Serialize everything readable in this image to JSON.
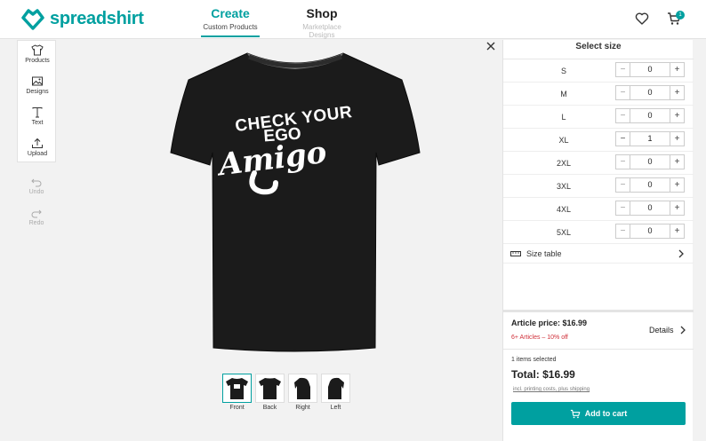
{
  "brand": {
    "name": "spreadshirt",
    "color": "#00a0a0"
  },
  "nav": {
    "tabs": [
      {
        "label": "Create",
        "sublabel": "Custom Products"
      },
      {
        "label": "Shop",
        "sublabel": "Marketplace Designs"
      }
    ],
    "cart_count": "1"
  },
  "tools": {
    "items": [
      {
        "label": "Products",
        "icon": "tshirt-icon"
      },
      {
        "label": "Designs",
        "icon": "image-icon"
      },
      {
        "label": "Text",
        "icon": "text-icon"
      },
      {
        "label": "Upload",
        "icon": "upload-icon"
      }
    ],
    "undo": "Undo",
    "redo": "Redo"
  },
  "design": {
    "line1": "CHECK YOUR",
    "line2": "EGO",
    "line3": "Amigo",
    "shirt_color": "#1b1b1b"
  },
  "views": [
    {
      "label": "Front"
    },
    {
      "label": "Back"
    },
    {
      "label": "Right"
    },
    {
      "label": "Left"
    }
  ],
  "panel": {
    "title": "Select size",
    "sizes": [
      {
        "size": "S",
        "qty": "0"
      },
      {
        "size": "M",
        "qty": "0"
      },
      {
        "size": "L",
        "qty": "0"
      },
      {
        "size": "XL",
        "qty": "1"
      },
      {
        "size": "2XL",
        "qty": "0"
      },
      {
        "size": "3XL",
        "qty": "0"
      },
      {
        "size": "4XL",
        "qty": "0"
      },
      {
        "size": "5XL",
        "qty": "0"
      }
    ],
    "size_table_label": "Size table",
    "article_price": "Article price: $16.99",
    "discount": "6+ Articles – 10% off",
    "details": "Details",
    "items_selected": "1 items selected",
    "total": "Total: $16.99",
    "incl": "incl. printing costs, plus shipping",
    "add_to_cart": "Add to cart"
  }
}
